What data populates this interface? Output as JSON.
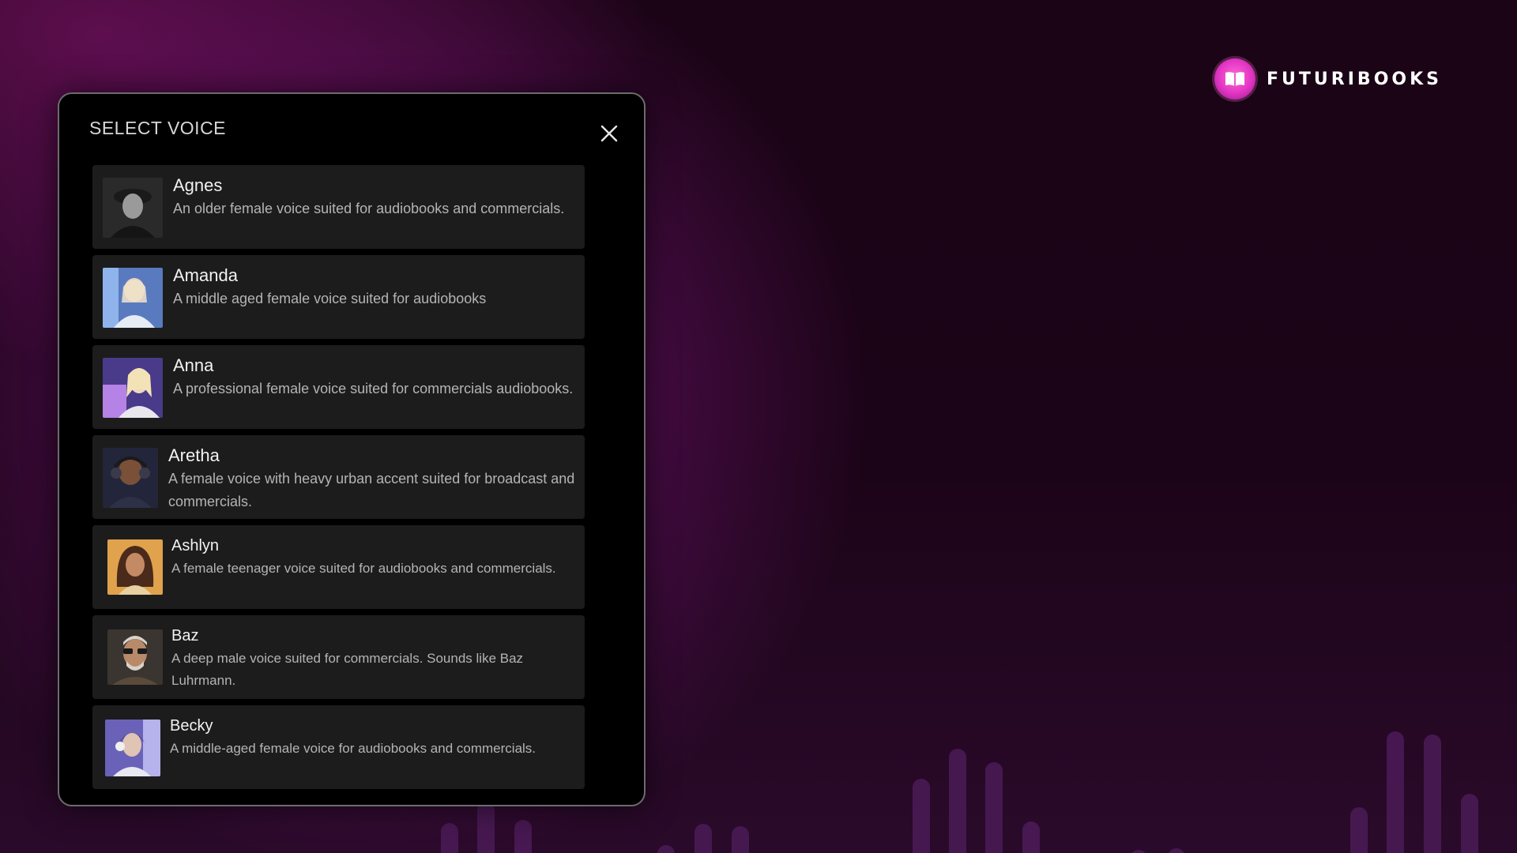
{
  "brand": {
    "name": "FUTURIBOOKS",
    "icon": "open-book-icon",
    "accent_color": "#e234c2"
  },
  "dialog": {
    "title": "SELECT VOICE",
    "close_icon": "close-icon"
  },
  "voices": [
    {
      "name": "Agnes",
      "description": "An older female voice suited for audiobooks and commercials.",
      "avatar_tone": "#6a6a6a"
    },
    {
      "name": "Amanda",
      "description": "A middle aged female voice suited for audiobooks",
      "avatar_tone": "#8fa7d6"
    },
    {
      "name": "Anna",
      "description": "A professional female voice suited for commercials audiobooks.",
      "avatar_tone": "#9a6fd0"
    },
    {
      "name": "Aretha",
      "description": "A female voice with heavy urban accent suited for broadcast and commercials.",
      "avatar_tone": "#3b3f5a"
    },
    {
      "name": "Ashlyn",
      "description": "A female teenager voice suited for audiobooks and commercials.",
      "avatar_tone": "#d99a4a"
    },
    {
      "name": "Baz",
      "description": "A deep male voice suited for commercials. Sounds like Baz Luhrmann.",
      "avatar_tone": "#8a7a66"
    },
    {
      "name": "Becky",
      "description": "A middle-aged female voice for audiobooks and commercials.",
      "avatar_tone": "#8a86d8"
    }
  ]
}
